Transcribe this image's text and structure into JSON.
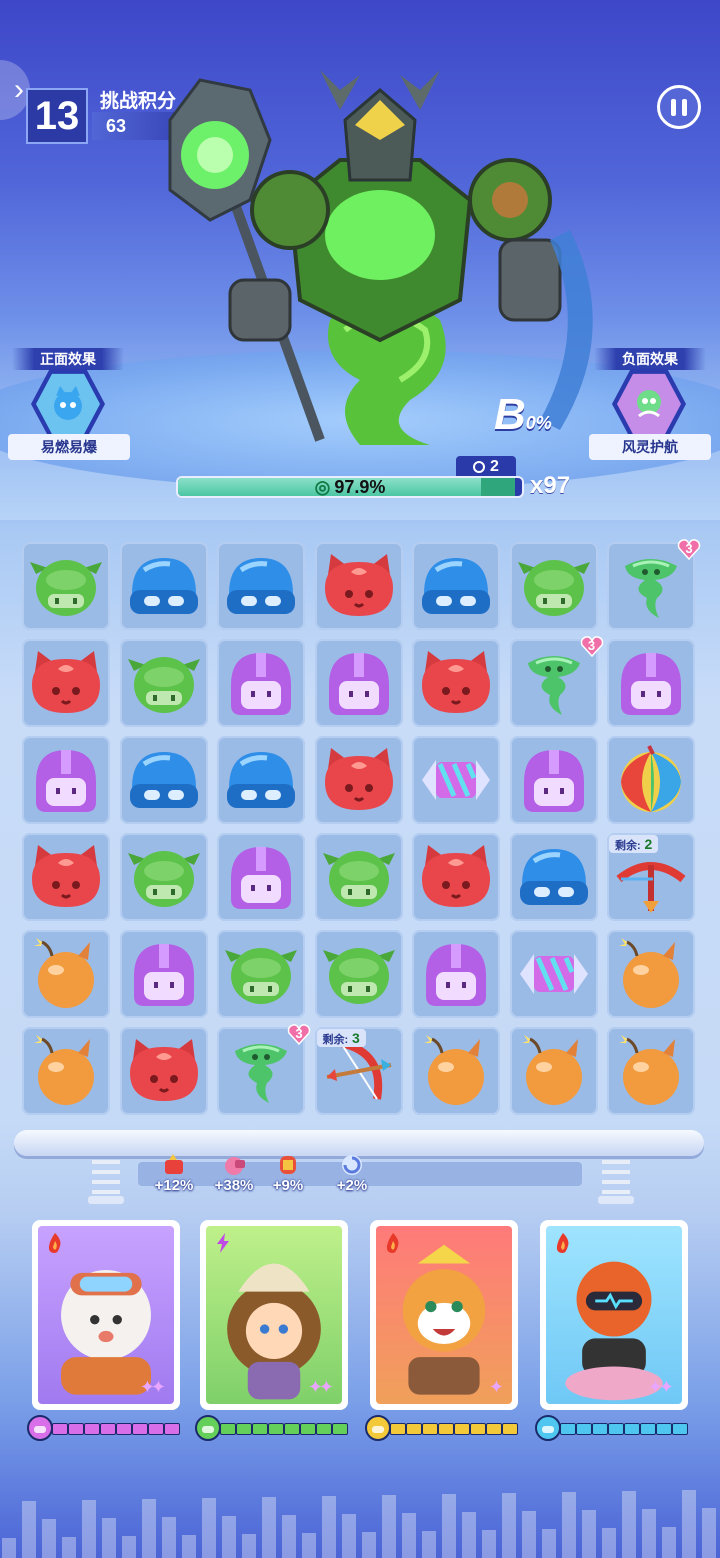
{
  "hud": {
    "level": "13",
    "score_title": "挑战积分",
    "score_value": "63"
  },
  "effects": {
    "positive_title": "正面效果",
    "positive_name": "易燃易爆",
    "negative_title": "负面效果",
    "negative_name": "风灵护航"
  },
  "boss": {
    "grade_letter": "B",
    "grade_percent": "0%",
    "turns_left": "2",
    "hp_percent_text": "97.9%",
    "hp_fraction": 0.979,
    "multiplier": "x97"
  },
  "board": {
    "rows": [
      [
        {
          "t": "green"
        },
        {
          "t": "blue"
        },
        {
          "t": "blue"
        },
        {
          "t": "red"
        },
        {
          "t": "blue"
        },
        {
          "t": "green"
        },
        {
          "t": "tornado",
          "hearts": "3"
        }
      ],
      [
        {
          "t": "red"
        },
        {
          "t": "green"
        },
        {
          "t": "purple"
        },
        {
          "t": "purple"
        },
        {
          "t": "red"
        },
        {
          "t": "tornado",
          "hearts": "3"
        },
        {
          "t": "purple"
        }
      ],
      [
        {
          "t": "purple"
        },
        {
          "t": "blue"
        },
        {
          "t": "blue"
        },
        {
          "t": "red"
        },
        {
          "t": "candy"
        },
        {
          "t": "purple"
        },
        {
          "t": "beachball"
        }
      ],
      [
        {
          "t": "red"
        },
        {
          "t": "green"
        },
        {
          "t": "purple"
        },
        {
          "t": "green"
        },
        {
          "t": "red"
        },
        {
          "t": "blue"
        },
        {
          "t": "crossbow",
          "remain_label": "剩余:",
          "remain": "2"
        }
      ],
      [
        {
          "t": "bomb"
        },
        {
          "t": "purple"
        },
        {
          "t": "green"
        },
        {
          "t": "green"
        },
        {
          "t": "purple"
        },
        {
          "t": "candy"
        },
        {
          "t": "bomb"
        }
      ],
      [
        {
          "t": "bomb"
        },
        {
          "t": "red"
        },
        {
          "t": "tornado",
          "hearts": "3"
        },
        {
          "t": "bow",
          "remain_label": "剩余:",
          "remain": "3"
        },
        {
          "t": "bomb"
        },
        {
          "t": "bomb"
        },
        {
          "t": "bomb"
        }
      ]
    ]
  },
  "buffs": [
    {
      "icon": "firecracker-icon",
      "text": "+12%"
    },
    {
      "icon": "cannon-icon",
      "text": "+38%"
    },
    {
      "icon": "lantern-icon",
      "text": "+9%"
    },
    {
      "icon": "swirl-icon",
      "text": "+2%"
    }
  ],
  "heroes": [
    {
      "name": "hero-bear-pilot",
      "element": "fire",
      "stars": "✦✦",
      "charge_color": "#d86ee8",
      "charge_icon": "purple-helmet"
    },
    {
      "name": "hero-lion-girl",
      "element": "lightning",
      "stars": "✦✦",
      "charge_color": "#64d05a",
      "charge_icon": "green-goblin"
    },
    {
      "name": "hero-tiger-monk",
      "element": "fire",
      "stars": "✦",
      "charge_color": "#f3c93a",
      "charge_icon": "red-cat"
    },
    {
      "name": "hero-robot-panda",
      "element": "fire",
      "stars": "✦✦",
      "charge_color": "#4fc6ef",
      "charge_icon": "blue-helmet"
    }
  ],
  "colors": {
    "green": "#5cc24a",
    "blue": "#2f8ee8",
    "red": "#e8464a",
    "purple": "#b360e6",
    "bomb": "#f19a3e"
  }
}
